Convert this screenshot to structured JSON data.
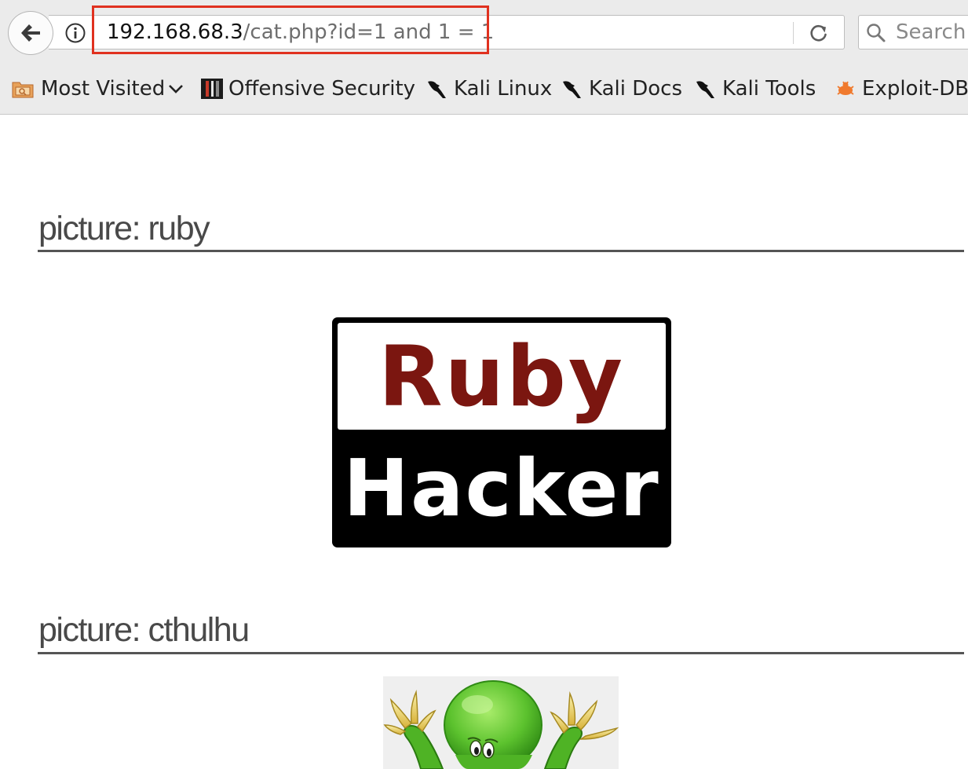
{
  "browser": {
    "address_bar": {
      "host": "192.168.68.3",
      "path": "/cat.php?id=1 and 1 = 1"
    },
    "search_placeholder": "Search",
    "bookmarks": [
      {
        "label": "Most Visited",
        "icon": "folder-icon"
      },
      {
        "label": "Offensive Security",
        "icon": "offensive-security-icon"
      },
      {
        "label": "Kali Linux",
        "icon": "kali-dragon-icon"
      },
      {
        "label": "Kali Docs",
        "icon": "kali-dragon-icon"
      },
      {
        "label": "Kali Tools",
        "icon": "kali-dragon-icon"
      },
      {
        "label": "Exploit-DB",
        "icon": "exploit-db-bug-icon"
      }
    ]
  },
  "page": {
    "pictures": [
      {
        "title": "picture: ruby",
        "logo_top": "Ruby",
        "logo_bottom": "Hacker"
      },
      {
        "title": "picture: cthulhu"
      }
    ]
  },
  "colors": {
    "highlight": "#e0311f",
    "ruby_red": "#7b1610",
    "cthulhu_green": "#5cc22e"
  }
}
